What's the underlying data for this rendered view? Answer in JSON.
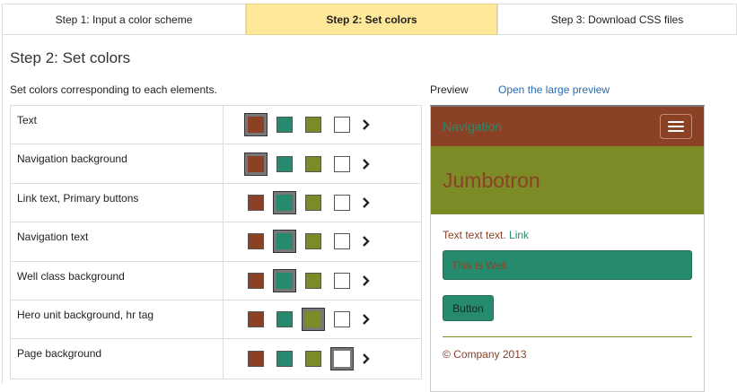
{
  "tabs": [
    {
      "label": "Step 1: Input a color scheme",
      "active": false
    },
    {
      "label": "Step 2: Set colors",
      "active": true
    },
    {
      "label": "Step 3: Download CSS files",
      "active": false
    }
  ],
  "page_title": "Step 2: Set colors",
  "instructions": "Set colors corresponding to each elements.",
  "preview_label": "Preview",
  "large_preview_link": "Open the large preview",
  "palette": [
    "#8b4126",
    "#268b6e",
    "#7d8b26",
    "#ffffff"
  ],
  "rows": [
    {
      "label": "Text",
      "selected": 0
    },
    {
      "label": "Navigation background",
      "selected": 0
    },
    {
      "label": "Link text, Primary buttons",
      "selected": 1
    },
    {
      "label": "Navigation text",
      "selected": 1
    },
    {
      "label": "Well class background",
      "selected": 1
    },
    {
      "label": "Hero unit background, hr tag",
      "selected": 2
    },
    {
      "label": "Page background",
      "selected": 3
    }
  ],
  "preview": {
    "nav_brand": "Navigation",
    "jumbotron": "Jumbotron",
    "body_text": "Text text text. ",
    "link_text": "Link",
    "well_text": "This is Well.",
    "button_label": "Button",
    "footer": "© Company 2013"
  }
}
